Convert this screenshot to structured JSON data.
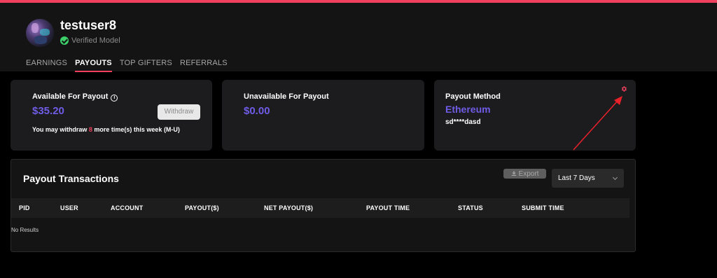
{
  "profile": {
    "username": "testuser8",
    "status": "Verified Model",
    "status_icon": "check-circle-icon",
    "status_color": "#3ccf6a"
  },
  "tabs": [
    {
      "label": "EARNINGS",
      "active": false
    },
    {
      "label": "PAYOUTS",
      "active": true
    },
    {
      "label": "TOP GIFTERS",
      "active": false
    },
    {
      "label": "REFERRALS",
      "active": false
    }
  ],
  "available": {
    "label": "Available For Payout",
    "info_icon": "info-icon",
    "amount": "$35.20",
    "withdraw_button": "Withdraw",
    "note_prefix": "You may withdraw",
    "note_count": "8",
    "note_suffix": "more time(s) this week (M-U)"
  },
  "unavailable": {
    "label": "Unavailable For Payout",
    "amount": "$0.00"
  },
  "payout_method": {
    "label": "Payout Method",
    "method": "Ethereum",
    "account": "sd****dasd",
    "settings_icon": "gear-icon"
  },
  "transactions": {
    "title": "Payout Transactions",
    "export_button": "Export",
    "export_icon": "download-icon",
    "range": "Last 7 Days",
    "columns": [
      "PID",
      "USER",
      "ACCOUNT",
      "PAYOUT($)",
      "NET PAYOUT($)",
      "PAYOUT TIME",
      "STATUS",
      "SUBMIT TIME"
    ],
    "empty_text": "No Results"
  },
  "colors": {
    "accent": "#f0405e",
    "amount": "#6f5ce6",
    "background": "#000000",
    "card": "#1c1c1e"
  }
}
